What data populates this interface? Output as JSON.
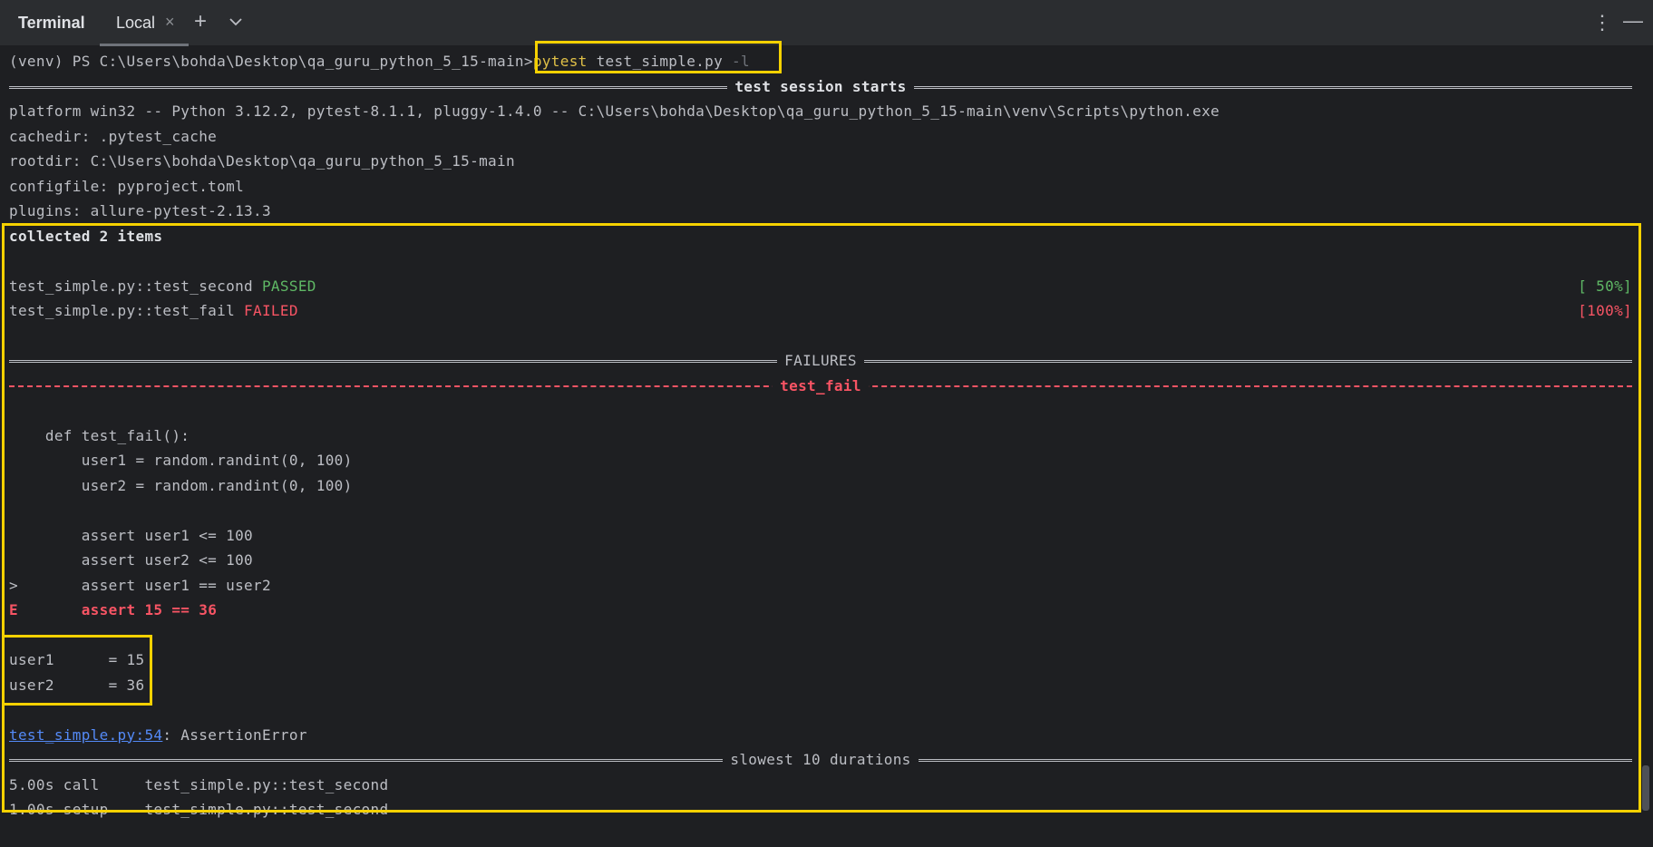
{
  "header": {
    "app_title": "Terminal",
    "tab_label": "Local",
    "tab_close": "×",
    "add": "+",
    "kebab": "⋮",
    "minimize": "—"
  },
  "terminal": {
    "prompt": "(venv) PS C:\\Users\\bohda\\Desktop\\qa_guru_python_5_15-main>",
    "cmd_keyword": "pytest",
    "cmd_args": " test_simple.py ",
    "cmd_flag": "-l",
    "session_title": "test session starts",
    "platform": "platform win32 -- Python 3.12.2, pytest-8.1.1, pluggy-1.4.0 -- C:\\Users\\bohda\\Desktop\\qa_guru_python_5_15-main\\venv\\Scripts\\python.exe",
    "cachedir": "cachedir: .pytest_cache",
    "rootdir": "rootdir: C:\\Users\\bohda\\Desktop\\qa_guru_python_5_15-main",
    "configfile": "configfile: pyproject.toml",
    "plugins": "plugins: allure-pytest-2.13.3",
    "collected": "collected 2 items",
    "result1_name": "test_simple.py::test_second ",
    "result1_status": "PASSED",
    "result1_pct": "[ 50%]",
    "result2_name": "test_simple.py::test_fail ",
    "result2_status": "FAILED",
    "result2_pct": "[100%]",
    "failures_title": "FAILURES",
    "fail_test_title": "test_fail",
    "code": [
      "    def test_fail():",
      "        user1 = random.randint(0, 100)",
      "        user2 = random.randint(0, 100)",
      "",
      "        assert user1 <= 100",
      "        assert user2 <= 100",
      ">       assert user1 == user2"
    ],
    "error_prefix": "E",
    "error_text": "       assert 15 == 36",
    "locals": [
      "user1      = 15",
      "user2      = 36"
    ],
    "location_link": "test_simple.py:54",
    "location_rest": ": AssertionError",
    "durations_title": "slowest 10 durations",
    "durations": [
      "5.00s call     test_simple.py::test_second",
      "1.00s setup    test_simple.py::test_second"
    ]
  }
}
